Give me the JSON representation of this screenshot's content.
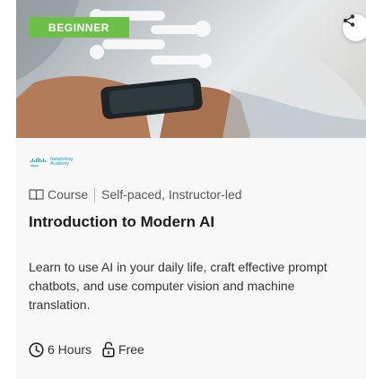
{
  "course": {
    "badge": "BEGINNER",
    "provider_logo": {
      "line1": "Networking",
      "line2": "Academy",
      "brand_mark": "cisco"
    },
    "type": "Course",
    "pacing": "Self-paced, Instructor-led",
    "title": "Introduction to Modern AI",
    "description_lines": [
      "Learn to use AI in your daily life, craft effective prompt",
      "chatbots, and use computer vision and machine",
      "translation."
    ],
    "duration": "6 Hours",
    "price": "Free"
  },
  "icons": {
    "share": "share-icon",
    "course_type": "book-icon",
    "duration": "clock-icon",
    "price": "lock-icon"
  },
  "colors": {
    "badge": "#6cc04a",
    "brand": "#049fd9",
    "title": "#1d1d1f",
    "text": "#333333"
  }
}
